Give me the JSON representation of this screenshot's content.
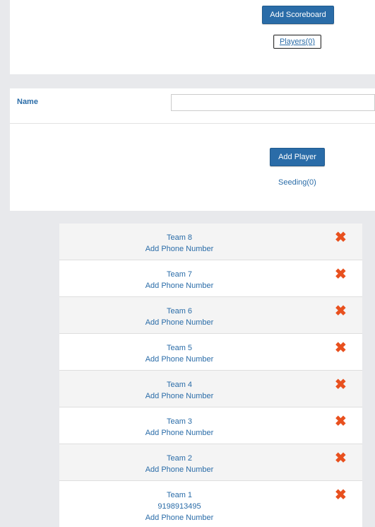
{
  "top": {
    "add_scoreboard_label": "Add Scoreboard",
    "players_link_label": "Players(0)"
  },
  "form": {
    "name_label": "Name",
    "name_value": "",
    "add_player_label": "Add Player",
    "seeding_label": "Seeding(0)"
  },
  "teams": [
    {
      "name": "Team 8",
      "phone": "",
      "add_phone_label": "Add Phone Number",
      "delete_icon": "✖"
    },
    {
      "name": "Team 7",
      "phone": "",
      "add_phone_label": "Add Phone Number",
      "delete_icon": "✖"
    },
    {
      "name": "Team 6",
      "phone": "",
      "add_phone_label": "Add Phone Number",
      "delete_icon": "✖"
    },
    {
      "name": "Team 5",
      "phone": "",
      "add_phone_label": "Add Phone Number",
      "delete_icon": "✖"
    },
    {
      "name": "Team 4",
      "phone": "",
      "add_phone_label": "Add Phone Number",
      "delete_icon": "✖"
    },
    {
      "name": "Team 3",
      "phone": "",
      "add_phone_label": "Add Phone Number",
      "delete_icon": "✖"
    },
    {
      "name": "Team 2",
      "phone": "",
      "add_phone_label": "Add Phone Number",
      "delete_icon": "✖"
    },
    {
      "name": "Team 1",
      "phone": "9198913495",
      "add_phone_label": "Add Phone Number",
      "delete_icon": "✖"
    }
  ],
  "colors": {
    "accent": "#2a6ca8",
    "delete": "#e8501e",
    "background": "#e8e9ec"
  }
}
